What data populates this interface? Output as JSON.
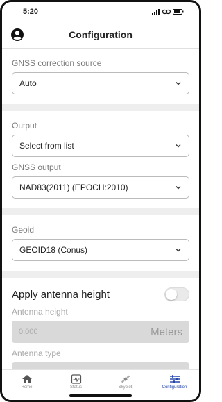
{
  "status_bar": {
    "time": "5:20"
  },
  "header": {
    "title": "Configuration"
  },
  "gnss_correction": {
    "label": "GNSS correction source",
    "value": "Auto"
  },
  "output": {
    "label": "Output",
    "value": "Select from list"
  },
  "gnss_output": {
    "label": "GNSS output",
    "value": "NAD83(2011) (EPOCH:2010)"
  },
  "geoid": {
    "label": "Geoid",
    "value": "GEOID18 (Conus)"
  },
  "antenna": {
    "apply_label": "Apply antenna height",
    "apply_on": false,
    "height_label": "Antenna height",
    "height_value": "0.000",
    "height_unit": "Meters",
    "type_label": "Antenna type"
  },
  "tabs": [
    {
      "label": "Home",
      "icon": "home-icon"
    },
    {
      "label": "Status",
      "icon": "status-icon"
    },
    {
      "label": "Skyplot",
      "icon": "satellite-icon"
    },
    {
      "label": "Configuration",
      "icon": "sliders-icon",
      "active": true
    }
  ],
  "colors": {
    "accent": "#2244aa",
    "disabled": "#d9d9d9",
    "separator": "#eeeeee"
  }
}
